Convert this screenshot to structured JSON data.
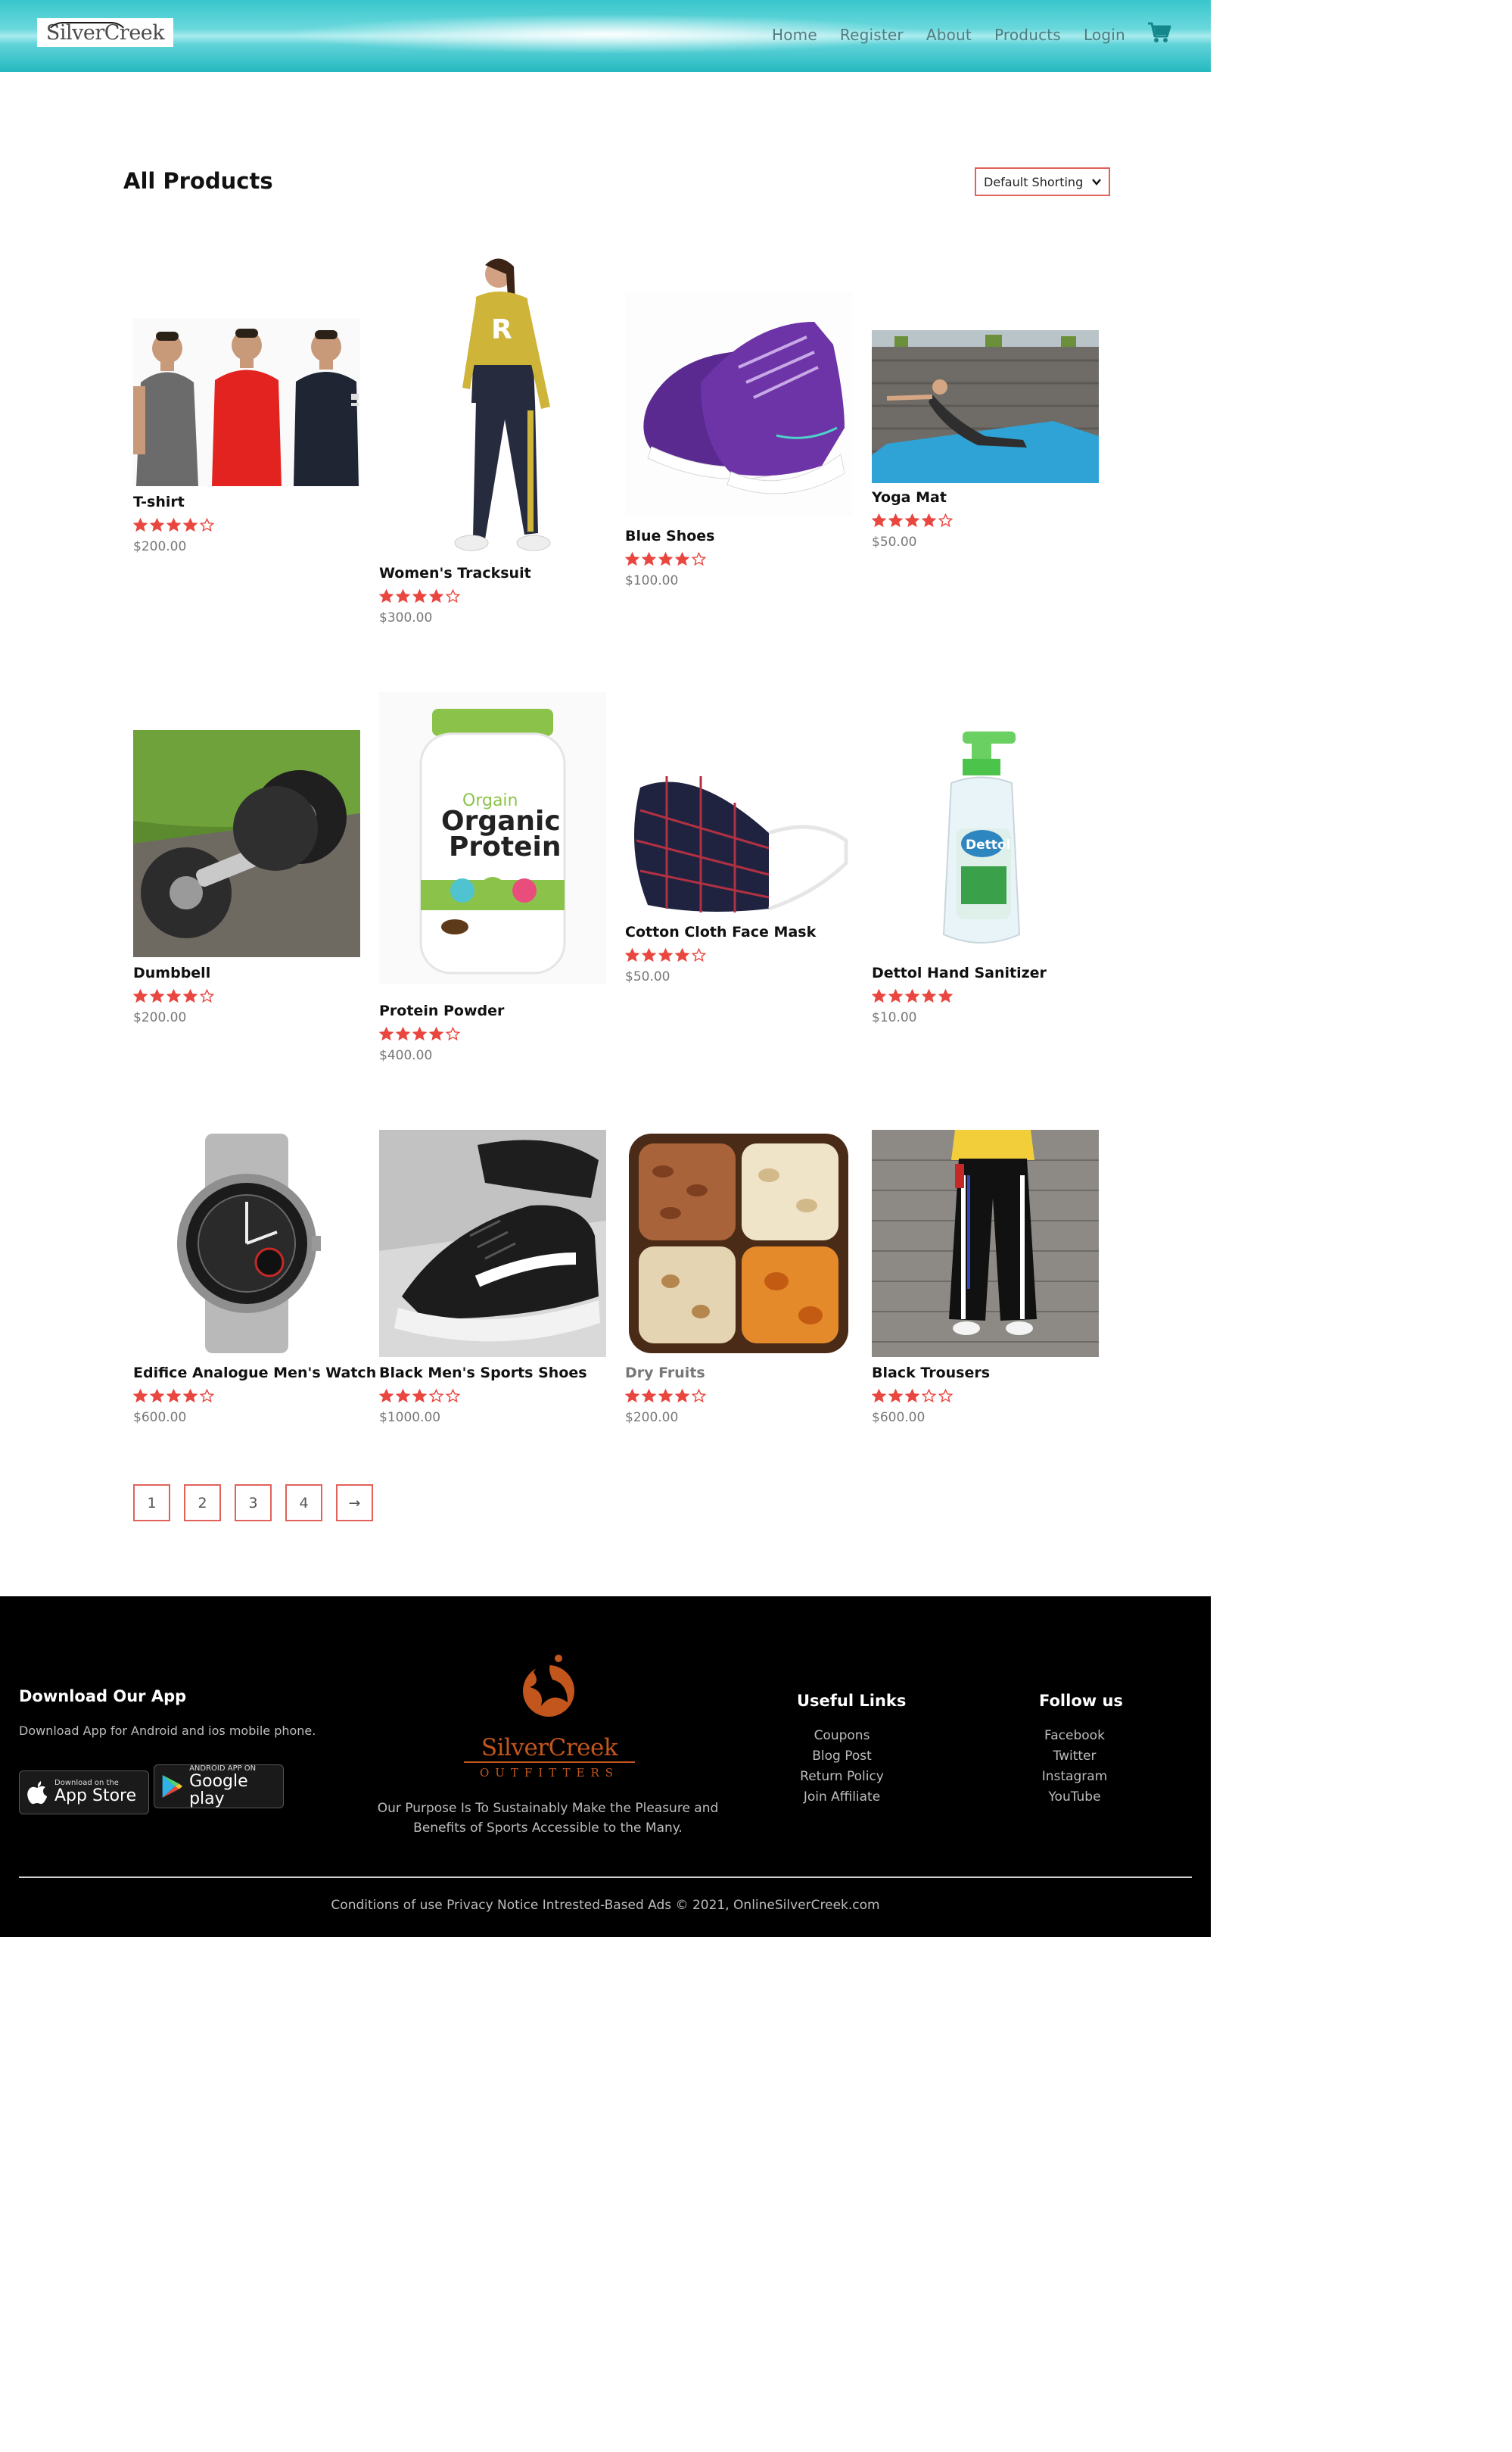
{
  "header": {
    "logo_text": "SilverCreek",
    "nav": [
      "Home",
      "Register",
      "About",
      "Products",
      "Login"
    ],
    "cart_icon": "cart-icon",
    "accent": "#2fc0c6"
  },
  "main": {
    "title": "All Products",
    "sort_label": "Default Shorting",
    "products": [
      {
        "name": "T-shirt",
        "rating": 4,
        "price": "$200.00"
      },
      {
        "name": "Women's Tracksuit",
        "rating": 4,
        "price": "$300.00"
      },
      {
        "name": "Blue Shoes",
        "rating": 4,
        "price": "$100.00"
      },
      {
        "name": "Yoga Mat",
        "rating": 4,
        "price": "$50.00"
      },
      {
        "name": "Dumbbell",
        "rating": 4,
        "price": "$200.00"
      },
      {
        "name": "Protein Powder",
        "rating": 4,
        "price": "$400.00"
      },
      {
        "name": "Cotton Cloth Face Mask",
        "rating": 4,
        "price": "$50.00"
      },
      {
        "name": "Dettol Hand Sanitizer",
        "rating": 5,
        "price": "$10.00"
      },
      {
        "name": "Edifice Analogue Men's Watch",
        "rating": 4,
        "price": "$600.00"
      },
      {
        "name": "Black Men's Sports Shoes",
        "rating": 3,
        "price": "$1000.00"
      },
      {
        "name": "Dry Fruits",
        "rating": 4,
        "price": "$200.00"
      },
      {
        "name": "Black Trousers",
        "rating": 3,
        "price": "$600.00"
      }
    ],
    "pagination": [
      "1",
      "2",
      "3",
      "4",
      "→"
    ],
    "star_color": "#e9463f"
  },
  "footer": {
    "app_title": "Download Our App",
    "app_text": "Download App for Android and ios mobile phone.",
    "app_store_small": "Download on the",
    "app_store_big": "App Store",
    "google_small": "ANDROID APP ON",
    "google_big": "Google play",
    "logo_main": "SilverCreek",
    "logo_sub": "OUTFITTERS",
    "purpose_1": "Our Purpose Is To Sustainably Make the Pleasure and",
    "purpose_2": "Benefits of Sports Accessible to the Many.",
    "useful_title": "Useful Links",
    "useful_links": [
      "Coupons",
      "Blog Post",
      "Return Policy",
      "Join Affiliate"
    ],
    "follow_title": "Follow us",
    "follow_links": [
      "Facebook",
      "Twitter",
      "Instagram",
      "YouTube"
    ],
    "copyright": "Conditions of use Privacy Notice Intrested-Based Ads © 2021, OnlineSilverCreek.com"
  }
}
